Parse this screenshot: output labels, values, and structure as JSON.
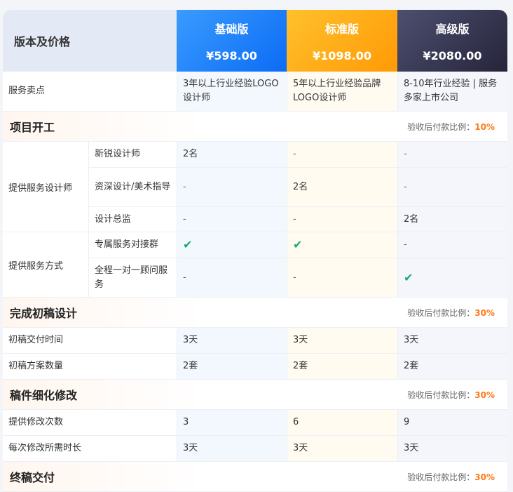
{
  "header": {
    "label": "版本及价格",
    "plans": [
      {
        "name": "基础版",
        "price": "¥598.00"
      },
      {
        "name": "标准版",
        "price": "¥1098.00"
      },
      {
        "name": "高级版",
        "price": "¥2080.00"
      }
    ]
  },
  "selling": {
    "label": "服务卖点",
    "values": [
      "3年以上行业经验LOGO设计师",
      "5年以上行业经验品牌LOGO设计师",
      "8-10年行业经验 | 服务多家上市公司"
    ]
  },
  "sec1": {
    "title": "项目开工",
    "ratio_label": "验收后付款比例：",
    "ratio": "10%"
  },
  "designers": {
    "label": "提供服务设计师",
    "rows": [
      {
        "name": "新锐设计师",
        "v": [
          "2名",
          "-",
          "-"
        ]
      },
      {
        "name": "资深设计/美术指导",
        "v": [
          "-",
          "2名",
          "-"
        ]
      },
      {
        "name": "设计总监",
        "v": [
          "-",
          "-",
          "2名"
        ]
      }
    ]
  },
  "method": {
    "label": "提供服务方式",
    "rows": [
      {
        "name": "专属服务对接群",
        "v": [
          "✔",
          "✔",
          "-"
        ]
      },
      {
        "name": "全程一对一顾问服务",
        "v": [
          "-",
          "-",
          "✔"
        ]
      }
    ]
  },
  "sec2": {
    "title": "完成初稿设计",
    "ratio_label": "验收后付款比例：",
    "ratio": "30%"
  },
  "draft": [
    {
      "name": "初稿交付时间",
      "v": [
        "3天",
        "3天",
        "3天"
      ]
    },
    {
      "name": "初稿方案数量",
      "v": [
        "2套",
        "2套",
        "2套"
      ]
    }
  ],
  "sec3": {
    "title": "稿件细化修改",
    "ratio_label": "验收后付款比例：",
    "ratio": "30%"
  },
  "revise": [
    {
      "name": "提供修改次数",
      "v": [
        "3",
        "6",
        "9"
      ]
    },
    {
      "name": "每次修改所需时长",
      "v": [
        "3天",
        "3天",
        "3天"
      ]
    }
  ],
  "sec4": {
    "title": "终稿交付",
    "ratio_label": "验收后付款比例：",
    "ratio": "30%"
  }
}
